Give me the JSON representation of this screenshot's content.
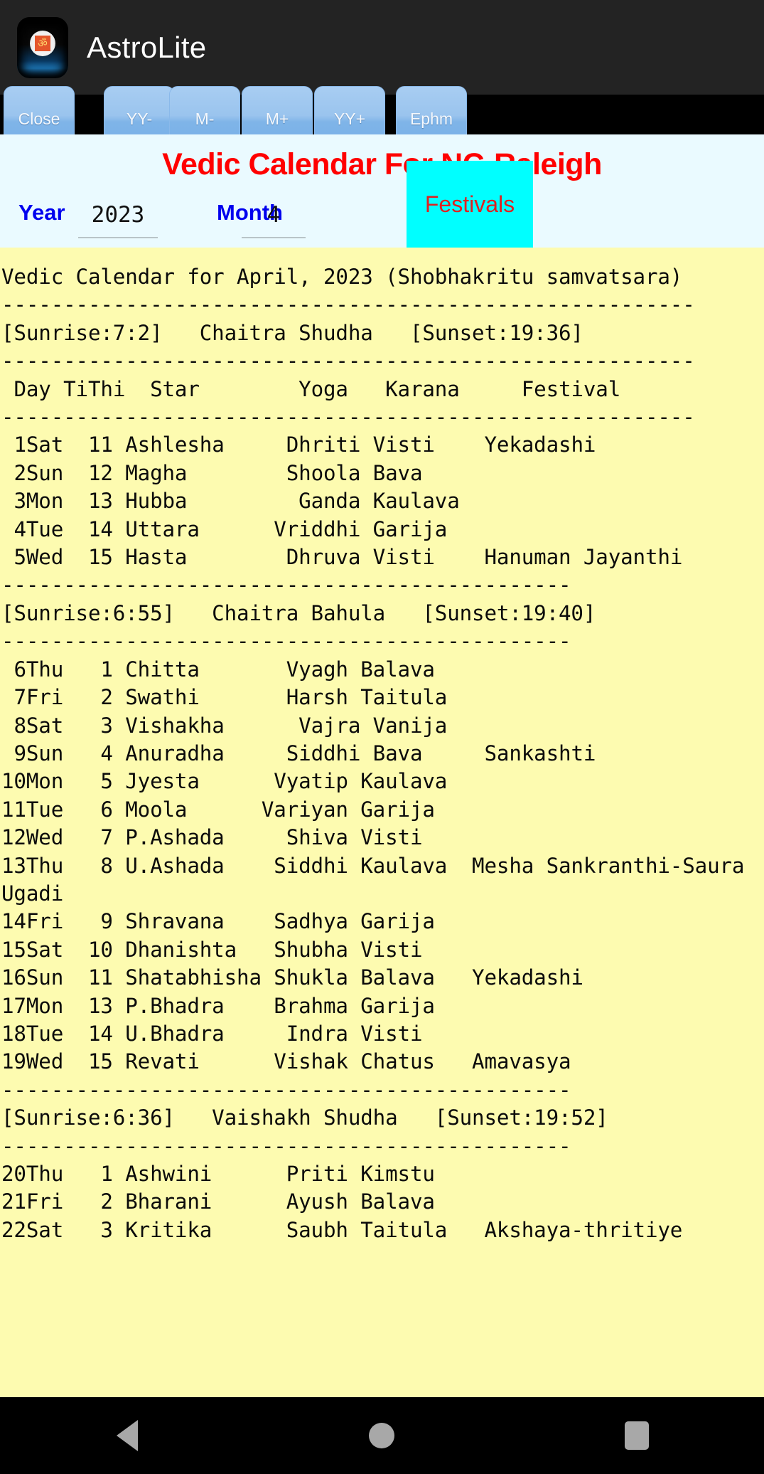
{
  "app": {
    "title": "AstroLite",
    "icon_name": "om-app-icon",
    "icon_glyph": "ॐ"
  },
  "toolbar": {
    "buttons": [
      {
        "label": "Close",
        "name": "close-button"
      },
      {
        "label": "YY-",
        "name": "year-decrement-button"
      },
      {
        "label": "M-",
        "name": "month-decrement-button"
      },
      {
        "label": "M+",
        "name": "month-increment-button"
      },
      {
        "label": "YY+",
        "name": "year-increment-button"
      },
      {
        "label": "Ephm",
        "name": "ephemeris-button"
      }
    ]
  },
  "panel": {
    "heading": "Vedic Calendar For NC-Raleigh",
    "heading_color": "#ff0000",
    "year_label": "Year",
    "year_value": "2023",
    "month_label": "Month",
    "month_value": "4",
    "festivals_label": "Festivals",
    "festivals_bg": "#00ffff",
    "festivals_fg": "#e02020",
    "label_color": "#0000ee"
  },
  "calendar": {
    "background": "#fdfbb0",
    "intro": "Vedic Calendar for April, 2023 (Shobhakritu samvatsara)",
    "separator_long": "--------------------------------------------------------",
    "separator_short": "----------------------------------------------",
    "columns": [
      "Day",
      "TiThi",
      "Star",
      "Yoga",
      "Karana",
      "Festival"
    ],
    "header_line": " Day TiThi  Star        Yoga   Karana     Festival",
    "blocks": [
      {
        "sunrise": "[Sunrise:7:2]",
        "paksha": "Chaitra Shudha",
        "sunset": "[Sunset:19:36]",
        "header_text": "[Sunrise:7:2]   Chaitra Shudha   [Sunset:19:36]",
        "rows": [
          {
            "day": "1Sat",
            "tithi": "11",
            "star": "Ashlesha",
            "yoga": "Dhriti",
            "karana": "Visti",
            "festival": "Yekadashi"
          },
          {
            "day": "2Sun",
            "tithi": "12",
            "star": "Magha",
            "yoga": "Shoola",
            "karana": "Bava",
            "festival": ""
          },
          {
            "day": "3Mon",
            "tithi": "13",
            "star": "Hubba",
            "yoga": "Ganda",
            "karana": "Kaulava",
            "festival": ""
          },
          {
            "day": "4Tue",
            "tithi": "14",
            "star": "Uttara",
            "yoga": "Vriddhi",
            "karana": "Garija",
            "festival": ""
          },
          {
            "day": "5Wed",
            "tithi": "15",
            "star": "Hasta",
            "yoga": "Dhruva",
            "karana": "Visti",
            "festival": "Hanuman Jayanthi"
          }
        ],
        "text": " 1Sat  11 Ashlesha     Dhriti Visti    Yekadashi\n 2Sun  12 Magha        Shoola Bava\n 3Mon  13 Hubba         Ganda Kaulava\n 4Tue  14 Uttara      Vriddhi Garija\n 5Wed  15 Hasta        Dhruva Visti    Hanuman Jayanthi"
      },
      {
        "sunrise": "[Sunrise:6:55]",
        "paksha": "Chaitra Bahula",
        "sunset": "[Sunset:19:40]",
        "header_text": "[Sunrise:6:55]   Chaitra Bahula   [Sunset:19:40]",
        "rows": [
          {
            "day": "6Thu",
            "tithi": "1",
            "star": "Chitta",
            "yoga": "Vyagh",
            "karana": "Balava",
            "festival": ""
          },
          {
            "day": "7Fri",
            "tithi": "2",
            "star": "Swathi",
            "yoga": "Harsh",
            "karana": "Taitula",
            "festival": ""
          },
          {
            "day": "8Sat",
            "tithi": "3",
            "star": "Vishakha",
            "yoga": "Vajra",
            "karana": "Vanija",
            "festival": ""
          },
          {
            "day": "9Sun",
            "tithi": "4",
            "star": "Anuradha",
            "yoga": "Siddhi",
            "karana": "Bava",
            "festival": "Sankashti"
          },
          {
            "day": "10Mon",
            "tithi": "5",
            "star": "Jyesta",
            "yoga": "Vyatip",
            "karana": "Kaulava",
            "festival": ""
          },
          {
            "day": "11Tue",
            "tithi": "6",
            "star": "Moola",
            "yoga": "Variyan",
            "karana": "Garija",
            "festival": ""
          },
          {
            "day": "12Wed",
            "tithi": "7",
            "star": "P.Ashada",
            "yoga": "Shiva",
            "karana": "Visti",
            "festival": ""
          },
          {
            "day": "13Thu",
            "tithi": "8",
            "star": "U.Ashada",
            "yoga": "Siddhi",
            "karana": "Kaulava",
            "festival": "Mesha Sankranthi-Saura Ugadi"
          },
          {
            "day": "14Fri",
            "tithi": "9",
            "star": "Shravana",
            "yoga": "Sadhya",
            "karana": "Garija",
            "festival": ""
          },
          {
            "day": "15Sat",
            "tithi": "10",
            "star": "Dhanishta",
            "yoga": "Shubha",
            "karana": "Visti",
            "festival": ""
          },
          {
            "day": "16Sun",
            "tithi": "11",
            "star": "Shatabhisha",
            "yoga": "Shukla",
            "karana": "Balava",
            "festival": "Yekadashi"
          },
          {
            "day": "17Mon",
            "tithi": "13",
            "star": "P.Bhadra",
            "yoga": "Brahma",
            "karana": "Garija",
            "festival": ""
          },
          {
            "day": "18Tue",
            "tithi": "14",
            "star": "U.Bhadra",
            "yoga": "Indra",
            "karana": "Visti",
            "festival": ""
          },
          {
            "day": "19Wed",
            "tithi": "15",
            "star": "Revati",
            "yoga": "Vishak",
            "karana": "Chatus",
            "festival": "Amavasya"
          }
        ],
        "text": " 6Thu   1 Chitta       Vyagh Balava\n 7Fri   2 Swathi       Harsh Taitula\n 8Sat   3 Vishakha      Vajra Vanija\n 9Sun   4 Anuradha     Siddhi Bava     Sankashti\n10Mon   5 Jyesta      Vyatip Kaulava\n11Tue   6 Moola      Variyan Garija\n12Wed   7 P.Ashada     Shiva Visti\n13Thu   8 U.Ashada    Siddhi Kaulava  Mesha Sankranthi-Saura Ugadi\n14Fri   9 Shravana    Sadhya Garija\n15Sat  10 Dhanishta   Shubha Visti\n16Sun  11 Shatabhisha Shukla Balava   Yekadashi\n17Mon  13 P.Bhadra    Brahma Garija\n18Tue  14 U.Bhadra     Indra Visti\n19Wed  15 Revati      Vishak Chatus   Amavasya"
      },
      {
        "sunrise": "[Sunrise:6:36]",
        "paksha": "Vaishakh Shudha",
        "sunset": "[Sunset:19:52]",
        "header_text": "[Sunrise:6:36]   Vaishakh Shudha   [Sunset:19:52]",
        "rows": [
          {
            "day": "20Thu",
            "tithi": "1",
            "star": "Ashwini",
            "yoga": "Priti",
            "karana": "Kimstu",
            "festival": ""
          },
          {
            "day": "21Fri",
            "tithi": "2",
            "star": "Bharani",
            "yoga": "Ayush",
            "karana": "Balava",
            "festival": ""
          },
          {
            "day": "22Sat",
            "tithi": "3",
            "star": "Kritika",
            "yoga": "Saubh",
            "karana": "Taitula",
            "festival": "Akshaya-thritiye"
          }
        ],
        "text": "20Thu   1 Ashwini      Priti Kimstu\n21Fri   2 Bharani      Ayush Balava\n22Sat   3 Kritika      Saubh Taitula   Akshaya-thritiye"
      }
    ],
    "full_text": "Vedic Calendar for April, 2023 (Shobhakritu samvatsara)\n--------------------------------------------------------\n[Sunrise:7:2]   Chaitra Shudha   [Sunset:19:36]\n--------------------------------------------------------\n Day TiThi  Star        Yoga   Karana     Festival\n--------------------------------------------------------\n 1Sat  11 Ashlesha     Dhriti Visti    Yekadashi\n 2Sun  12 Magha        Shoola Bava\n 3Mon  13 Hubba         Ganda Kaulava\n 4Tue  14 Uttara      Vriddhi Garija\n 5Wed  15 Hasta        Dhruva Visti    Hanuman Jayanthi\n----------------------------------------------\n[Sunrise:6:55]   Chaitra Bahula   [Sunset:19:40]\n----------------------------------------------\n 6Thu   1 Chitta       Vyagh Balava\n 7Fri   2 Swathi       Harsh Taitula\n 8Sat   3 Vishakha      Vajra Vanija\n 9Sun   4 Anuradha     Siddhi Bava     Sankashti\n10Mon   5 Jyesta      Vyatip Kaulava\n11Tue   6 Moola      Variyan Garija\n12Wed   7 P.Ashada     Shiva Visti\n13Thu   8 U.Ashada    Siddhi Kaulava  Mesha Sankranthi-Saura Ugadi\n14Fri   9 Shravana    Sadhya Garija\n15Sat  10 Dhanishta   Shubha Visti\n16Sun  11 Shatabhisha Shukla Balava   Yekadashi\n17Mon  13 P.Bhadra    Brahma Garija\n18Tue  14 U.Bhadra     Indra Visti\n19Wed  15 Revati      Vishak Chatus   Amavasya\n----------------------------------------------\n[Sunrise:6:36]   Vaishakh Shudha   [Sunset:19:52]\n----------------------------------------------\n20Thu   1 Ashwini      Priti Kimstu\n21Fri   2 Bharani      Ayush Balava\n22Sat   3 Kritika      Saubh Taitula   Akshaya-thritiye"
  },
  "navbar": {
    "back": "back-triangle",
    "home": "home-circle",
    "recents": "recents-square"
  }
}
